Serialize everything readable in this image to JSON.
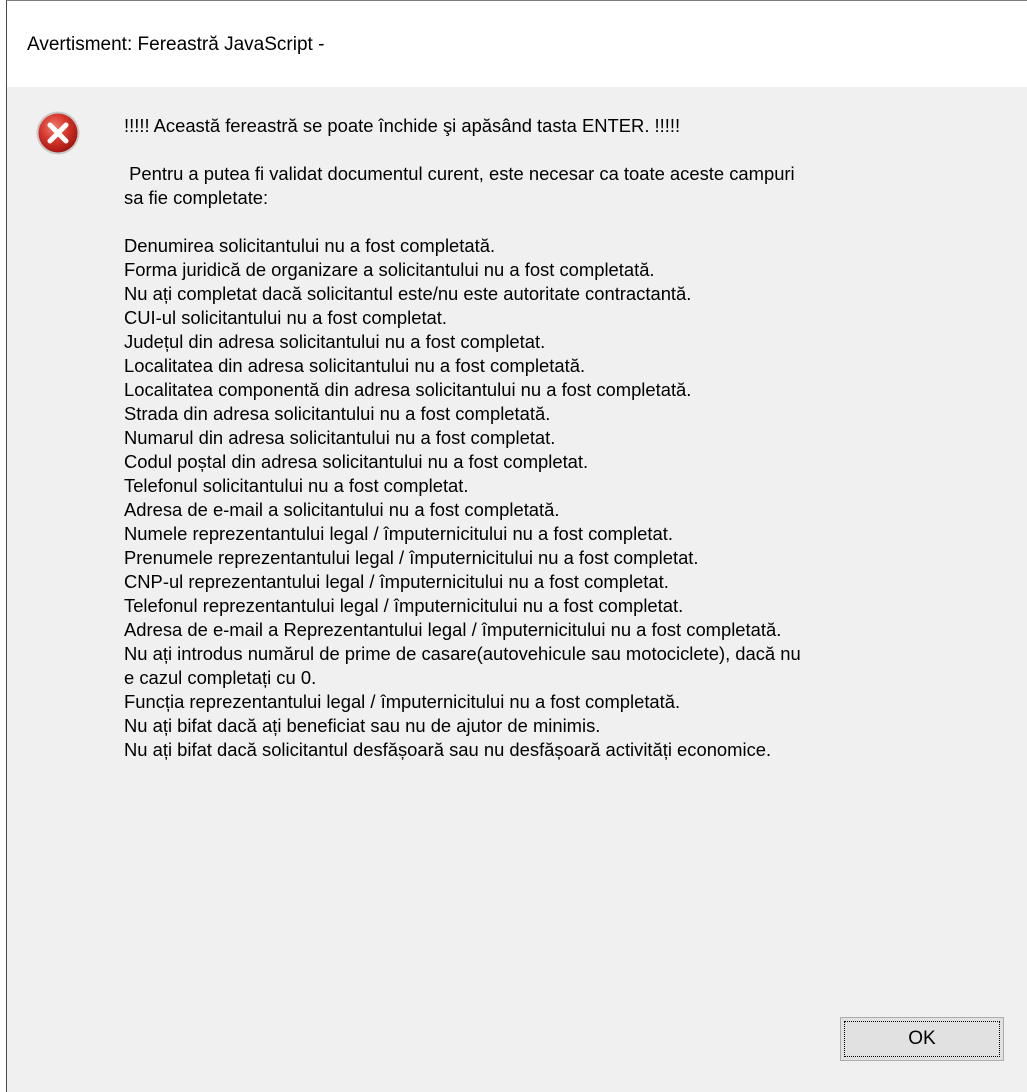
{
  "dialog": {
    "title": "Avertisment: Fereastră JavaScript -",
    "icon": "error-icon",
    "accent_color": "#d32f2f",
    "message_lines": [
      "!!!!! Această fereastră se poate închide şi apăsând tasta ENTER. !!!!!",
      "",
      " Pentru a putea fi validat documentul curent, este necesar ca toate aceste campuri",
      "sa fie completate:",
      "",
      "Denumirea solicitantului nu a fost completată.",
      "Forma juridică de organizare a solicitantului nu a fost completată.",
      "Nu ați completat dacă solicitantul este/nu este autoritate contractantă.",
      "CUI-ul solicitantului nu a fost completat.",
      "Județul din adresa solicitantului nu a fost completat.",
      "Localitatea din adresa solicitantului nu a fost completată.",
      "Localitatea componentă din adresa solicitantului nu a fost completată.",
      "Strada din adresa solicitantului nu a fost completată.",
      "Numarul din adresa solicitantului nu a fost completat.",
      "Codul poștal din adresa solicitantului nu a fost completat.",
      "Telefonul solicitantului nu a fost completat.",
      "Adresa de e-mail a solicitantului nu a fost completată.",
      "Numele reprezentantului legal / împuternicitului nu a fost completat.",
      "Prenumele reprezentantului legal / împuternicitului nu a fost completat.",
      "CNP-ul reprezentantului legal / împuternicitului nu a fost completat.",
      "Telefonul reprezentantului legal / împuternicitului nu a fost completat.",
      "Adresa de e-mail a Reprezentantului legal / împuternicitului nu a fost completată.",
      "Nu ați introdus numărul de prime de casare(autovehicule sau motociclete), dacă nu",
      "e cazul completați cu 0.",
      "Funcția reprezentantului legal / împuternicitului nu a fost completată.",
      "Nu ați bifat dacă ați beneficiat sau nu de ajutor de minimis.",
      "Nu ați bifat dacă solicitantul desfășoară sau nu desfășoară activități economice."
    ],
    "ok_label": "OK"
  }
}
